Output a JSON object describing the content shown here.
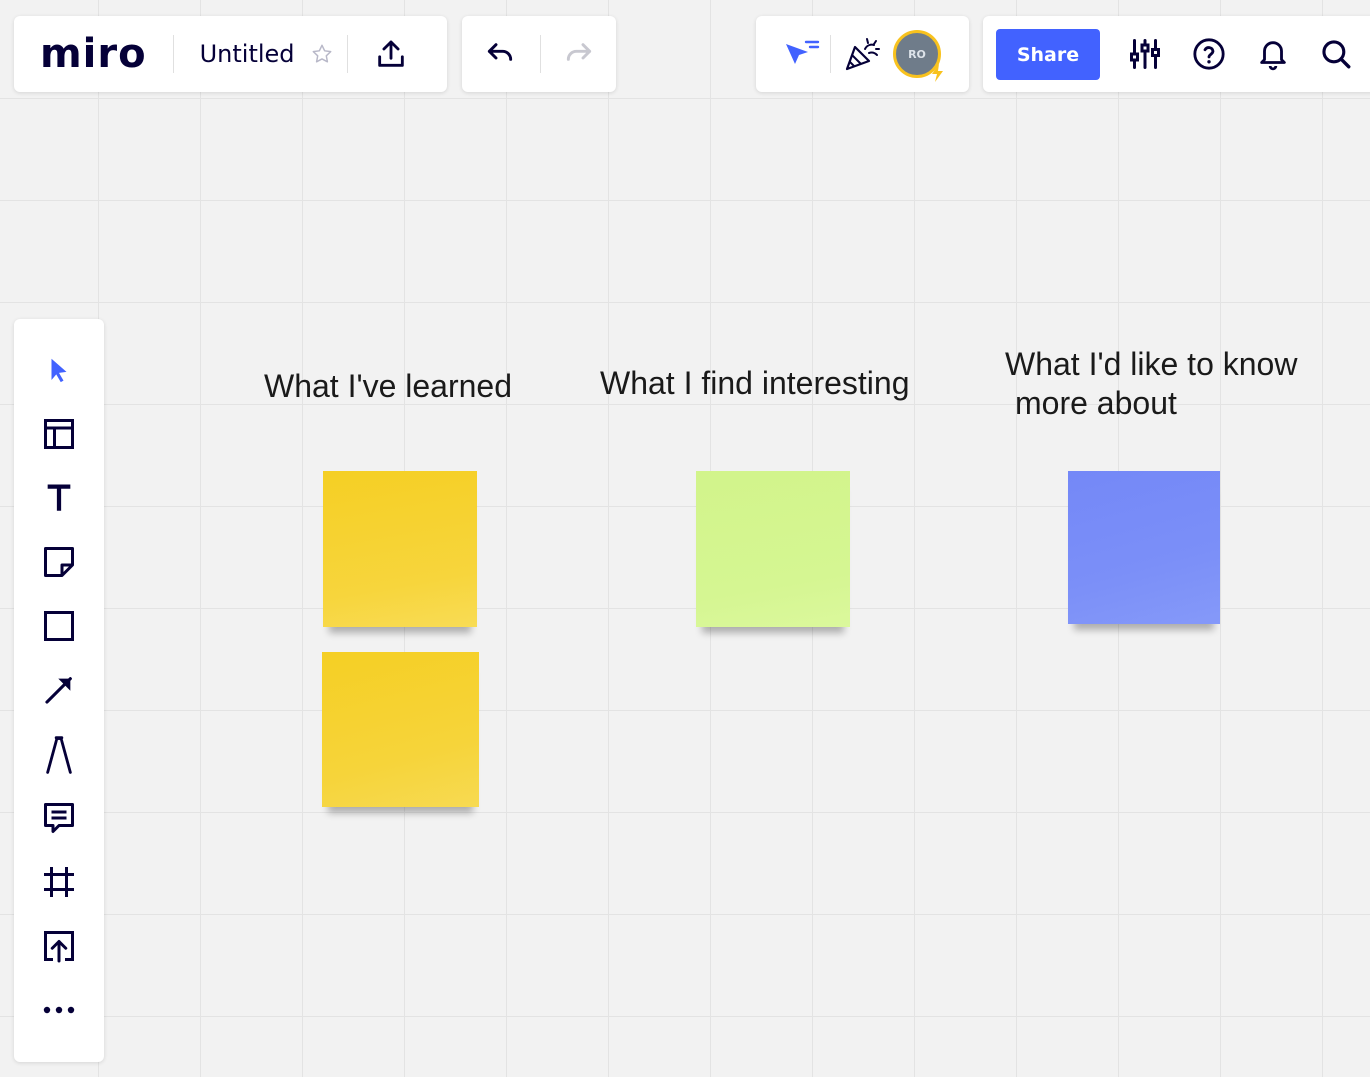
{
  "header": {
    "logo": "miro",
    "board_title": "Untitled",
    "share_label": "Share",
    "avatar_initials": "RO"
  },
  "icons": {
    "favorite": "star-icon",
    "export": "upload-icon",
    "undo": "undo-icon",
    "redo": "redo-icon",
    "cursor_tracker": "cursor-flag-icon",
    "celebrate": "party-popper-icon",
    "settings": "sliders-icon",
    "help": "help-circle-icon",
    "notifications": "bell-icon",
    "search": "search-icon"
  },
  "colors": {
    "accent": "#4262ff",
    "sticky_yellow": "#f5d128",
    "sticky_green": "#d5f692",
    "sticky_blue": "#7b8ff8"
  },
  "toolbar": {
    "tools": [
      "select",
      "templates",
      "text",
      "sticky-note",
      "shape",
      "connection-line",
      "pen",
      "comment",
      "frame",
      "upload",
      "more"
    ]
  },
  "board": {
    "columns": [
      {
        "title": "What I've learned"
      },
      {
        "title": "What I find interesting"
      },
      {
        "title_line1": "What I'd like to know",
        "title_line2": "more about"
      }
    ]
  }
}
